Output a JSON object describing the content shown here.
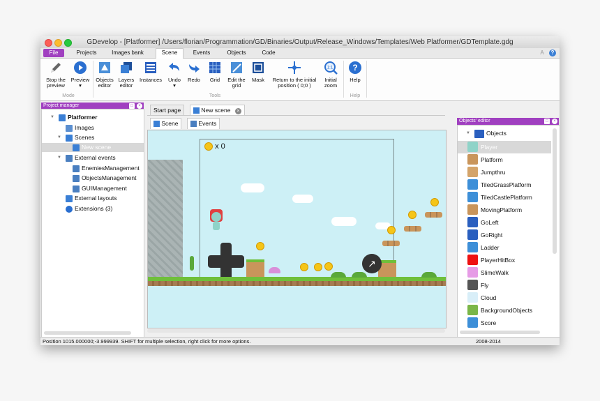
{
  "window": {
    "title": "GDevelop - [Platformer] /Users/florian/Programmation/GD/Binaries/Output/Release_Windows/Templates/Web Platformer/GDTemplate.gdg"
  },
  "ribbon_tabs": [
    "File",
    "Projects",
    "Images bank",
    "Scene",
    "Events",
    "Objects",
    "Code"
  ],
  "ribbon_right": [
    "A",
    "?"
  ],
  "ribbon": {
    "stop_preview": "Stop the preview",
    "preview": "Preview",
    "mode_group": "Mode",
    "objects_editor": "Objects editor",
    "layers_editor": "Layers editor",
    "instances": "Instances",
    "undo": "Undo",
    "redo": "Redo",
    "grid": "Grid",
    "edit_grid": "Edit the grid",
    "mask": "Mask",
    "return_origin": "Return to the initial position ( 0;0 )",
    "initial_zoom": "Initial zoom",
    "tools_group": "Tools",
    "help": "Help",
    "help_group": "Help"
  },
  "project_manager": {
    "title": "Project manager",
    "tree": [
      {
        "label": "Platformer",
        "bold": true
      },
      {
        "label": "Images"
      },
      {
        "label": "Scenes"
      },
      {
        "label": "New scene",
        "selected": true
      },
      {
        "label": "External events"
      },
      {
        "label": "EnemiesManagement"
      },
      {
        "label": "ObjectsManagement"
      },
      {
        "label": "GUIManagement"
      },
      {
        "label": "External layouts"
      },
      {
        "label": "Extensions (3)"
      }
    ]
  },
  "doc_tabs": [
    "Start page",
    "New scene"
  ],
  "sub_tabs": [
    "Scene",
    "Events"
  ],
  "scene": {
    "coin_counter": "x 0"
  },
  "objects_editor": {
    "title": "Objects' editor",
    "root": "Objects",
    "items": [
      {
        "label": "Player",
        "color": "#8fd3c8",
        "selected": true
      },
      {
        "label": "Platform",
        "color": "#c9955b"
      },
      {
        "label": "Jumpthru",
        "color": "#d4a46a"
      },
      {
        "label": "TiledGrassPlatform",
        "color": "#3d8fd8"
      },
      {
        "label": "TiledCastlePlatform",
        "color": "#3d8fd8"
      },
      {
        "label": "MovingPlatform",
        "color": "#c9955b"
      },
      {
        "label": "GoLeft",
        "color": "#2a5fbf"
      },
      {
        "label": "GoRight",
        "color": "#2a5fbf"
      },
      {
        "label": "Ladder",
        "color": "#3d8fd8"
      },
      {
        "label": "PlayerHitBox",
        "color": "#ee1111"
      },
      {
        "label": "SlimeWalk",
        "color": "#e69be6"
      },
      {
        "label": "Fly",
        "color": "#555555"
      },
      {
        "label": "Cloud",
        "color": "#d8eef8"
      },
      {
        "label": "BackgroundObjects",
        "color": "#7ab648"
      },
      {
        "label": "Score",
        "color": "#3d8fd8"
      }
    ]
  },
  "status": {
    "left": "Position 1015.000000;-3.999939. SHIFT for multiple selection, right click for more options.",
    "right": "2008-2014"
  },
  "colors": {
    "accent": "#a040c0",
    "sky": "#cdf0f6",
    "grass": "#6fbf3a",
    "dirt": "#a57c52"
  }
}
